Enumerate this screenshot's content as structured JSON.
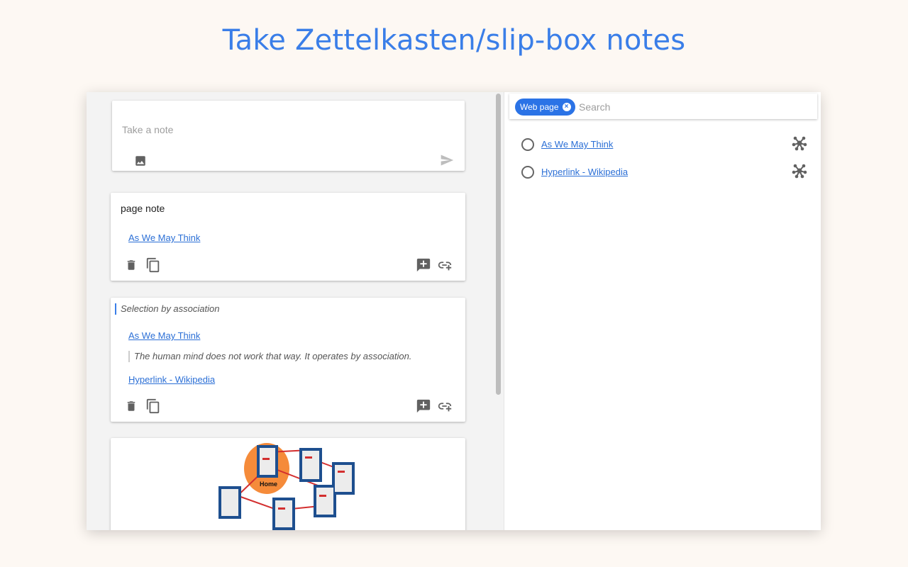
{
  "headline": "Take Zettelkasten/slip-box notes",
  "composer": {
    "placeholder": "Take a note"
  },
  "notes": [
    {
      "title": "page note",
      "links": [
        "As We May Think"
      ]
    },
    {
      "selection": "Selection by association",
      "link1": "As We May Think",
      "quote": "The human mind does not work that way. It operates by association.",
      "link2": "Hyperlink - Wikipedia"
    },
    {
      "image_label": "Home"
    }
  ],
  "right_panel": {
    "chip": "Web page",
    "search_placeholder": "Search",
    "items": [
      {
        "label": "As We May Think"
      },
      {
        "label": "Hyperlink - Wikipedia"
      }
    ]
  }
}
